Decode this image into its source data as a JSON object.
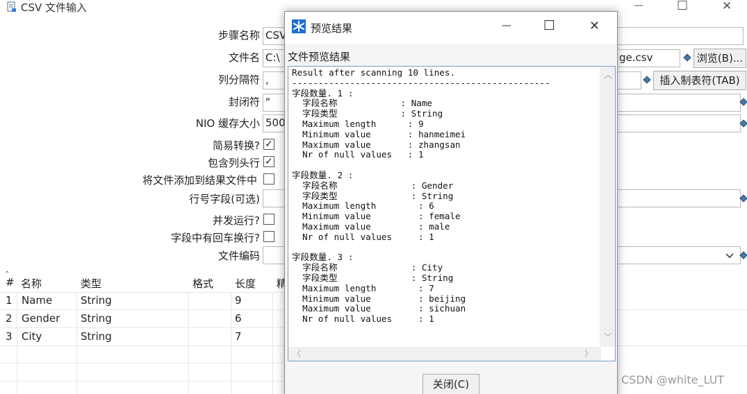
{
  "window": {
    "title": "CSV 文件输入",
    "minimize": "—",
    "maximize": "☐",
    "close": "✕"
  },
  "form": {
    "step_name_label": "步骤名称",
    "step_name_value": "CSV",
    "file_name_label": "文件名",
    "file_name_value_left": "C:\\",
    "file_name_value_right": "ge.csv",
    "browse_button": "浏览(B)...",
    "delimiter_label": "列分隔符",
    "delimiter_value": ",",
    "insert_tab_button": "插入制表符(TAB)",
    "enclosure_label": "封闭符",
    "enclosure_value": "\"",
    "nio_label": "NIO 缓存大小",
    "nio_value": "500",
    "lazy_conversion_label": "简易转换?",
    "lazy_conversion_checked": "✓",
    "header_row_label": "包含列头行",
    "header_row_checked": "✓",
    "add_to_result_label": "将文件添加到结果文件中",
    "row_number_label": "行号字段(可选)",
    "parallel_label": "并发运行?",
    "newline_label": "字段中有回车换行?",
    "encoding_label": "文件编码",
    "encoding_dropdown_icon": "chevron-down-icon"
  },
  "grid": {
    "headers": [
      "#",
      "名称",
      "类型",
      "格式",
      "长度",
      "精"
    ],
    "rows": [
      {
        "num": "1",
        "name": "Name",
        "type": "String",
        "length": "9"
      },
      {
        "num": "2",
        "name": "Gender",
        "type": "String",
        "length": "6"
      },
      {
        "num": "3",
        "name": "City",
        "type": "String",
        "length": "7"
      }
    ]
  },
  "dialog": {
    "title": "预览结果",
    "minimize": "—",
    "maximize": "☐",
    "close": "✕",
    "section_label": "文件预览结果",
    "result_lines": [
      "Result after scanning 10 lines.",
      "-------------------------------------------------",
      "字段数量. 1 :",
      "  字段名称            : Name",
      "  字段类型            : String",
      "  Maximum length      : 9",
      "  Minimum value       : hanmeimei",
      "  Maximum value       : zhangsan",
      "  Nr of null values   : 1",
      "",
      "字段数量. 2 :",
      "  字段名称              : Gender",
      "  字段类型              : String",
      "  Maximum length        : 6",
      "  Minimum value         : female",
      "  Maximum value         : male",
      "  Nr of null values     : 1",
      "",
      "字段数量. 3 :",
      "  字段名称              : City",
      "  字段类型              : String",
      "  Maximum length        : 7",
      "  Minimum value         : beijing",
      "  Maximum value         : sichuan",
      "  Nr of null values     : 1"
    ],
    "close_button": "关闭(C)"
  },
  "watermark": "CSDN @white_LUT",
  "colors": {
    "dialog_icon": "#1e6fd9",
    "field_border": "#b8b8b8",
    "result_border": "#7a9cc7"
  }
}
